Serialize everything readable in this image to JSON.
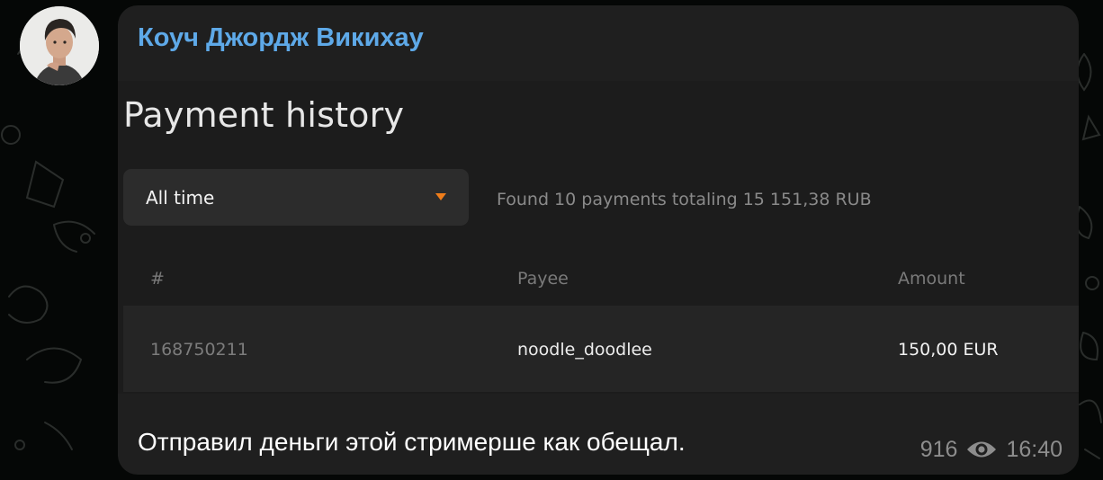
{
  "message": {
    "sender_name": "Коуч Джордж Викихау",
    "sender_color": "#5ea9e8",
    "avatar_icon": "person-portrait",
    "text": "Отправил деньги этой стримерше как обещал.",
    "views": "916",
    "views_icon": "eye-icon",
    "time": "16:40"
  },
  "screenshot": {
    "title": "Payment history",
    "filter": {
      "selected": "All time",
      "icon": "dropdown-caret",
      "accent": "#f07d1a"
    },
    "summary": "Found 10 payments totaling 15 151,38 RUB",
    "columns": [
      "#",
      "Payee",
      "Amount"
    ],
    "rows": [
      {
        "id": "168750211",
        "payee": "noodle_doodlee",
        "amount": "150,00 EUR"
      }
    ]
  }
}
